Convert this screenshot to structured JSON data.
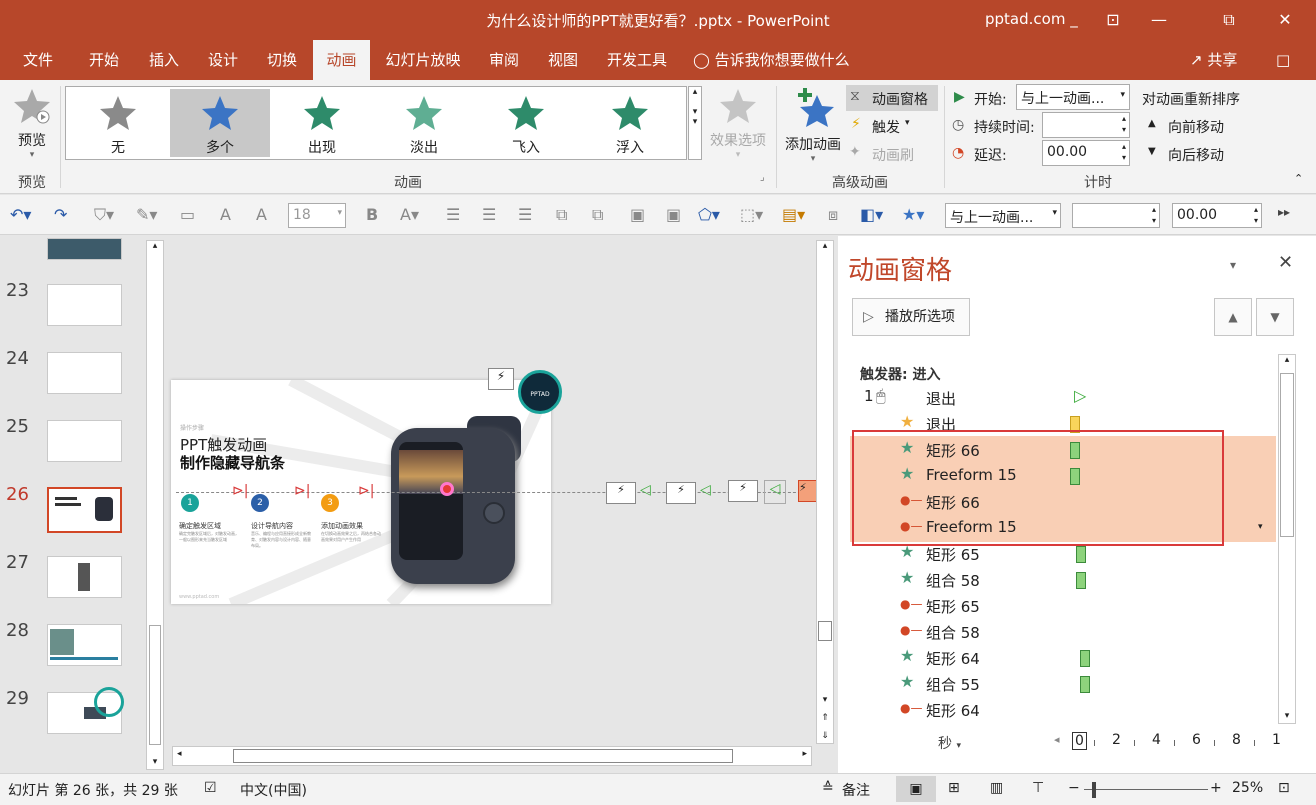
{
  "window": {
    "title": "为什么设计师的PPT就更好看？.pptx  -  PowerPoint",
    "account": "pptad.com _",
    "min": "—",
    "restore": "⧉",
    "close": "✕",
    "ribbon_opt": "⊡"
  },
  "tabs": [
    {
      "label": "文件"
    },
    {
      "label": "开始"
    },
    {
      "label": "插入"
    },
    {
      "label": "设计"
    },
    {
      "label": "切换"
    },
    {
      "label": "动画"
    },
    {
      "label": "幻灯片放映"
    },
    {
      "label": "审阅"
    },
    {
      "label": "视图"
    },
    {
      "label": "开发工具"
    },
    {
      "label": "告诉我你想要做什么"
    }
  ],
  "share_label": "共享",
  "ribbon": {
    "preview_label": "预览",
    "preview_group": "预览",
    "gallery": [
      {
        "label": "无",
        "color": "#8a8a8a"
      },
      {
        "label": "多个",
        "color": "#3b74c4"
      },
      {
        "label": "出现",
        "color": "#2e8b6a"
      },
      {
        "label": "淡出",
        "color": "#5fae93"
      },
      {
        "label": "飞入",
        "color": "#2e8b6a"
      },
      {
        "label": "浮入",
        "color": "#2e8b6a"
      }
    ],
    "effect_options": "效果选项",
    "animation_group": "动画",
    "add_animation": "添加动画",
    "anim_pane": "动画窗格",
    "trigger": "触发",
    "anim_painter": "动画刷",
    "advanced_group": "高级动画",
    "start_label": "开始:",
    "start_value": "与上一动画...",
    "duration_label": "持续时间:",
    "duration_value": "",
    "delay_label": "延迟:",
    "delay_value": "00.00",
    "reorder_label": "对动画重新排序",
    "move_earlier": "向前移动",
    "move_later": "向后移动",
    "timing_group": "计时"
  },
  "toolbar": {
    "font_size": "18",
    "start_value": "与上一动画...",
    "duration_value": "",
    "delay_value": "00.00"
  },
  "thumbnails": [
    {
      "num": "23"
    },
    {
      "num": "24"
    },
    {
      "num": "25"
    },
    {
      "num": "26"
    },
    {
      "num": "27"
    },
    {
      "num": "28"
    },
    {
      "num": "29"
    }
  ],
  "slide": {
    "kicker": "操作步骤",
    "title1": "PPT触发动画",
    "title2": "制作隐藏导航条",
    "badge": "PPTAD",
    "steps": [
      {
        "num": "1",
        "label": "确定触发区域",
        "desc": "确定完触发区域后，对触发动画，一般以图形来充当触发区域",
        "color": "#1aa39a"
      },
      {
        "num": "2",
        "label": "设计导航内容",
        "desc": "音乐、编程与应用直接形成全新教育、对触发内容与设计内容、随意布局。",
        "color": "#2b5fa8"
      },
      {
        "num": "3",
        "label": "添加动画效果",
        "desc": "在切换动画效果之后，再结合各动画效果对用户产生作用",
        "color": "#f39c12"
      }
    ],
    "footer": "www.pptad.com"
  },
  "anim_pane": {
    "title": "动画窗格",
    "play": "播放所选项",
    "trigger_header": "触发器: 进入",
    "rows": [
      {
        "num": "1",
        "icon": "mouse",
        "label": "退出",
        "bar": "play"
      },
      {
        "num": "",
        "icon": "star-yellow",
        "label": "退出",
        "bar": "yellow"
      },
      {
        "num": "",
        "icon": "star",
        "label": "矩形 66",
        "bar": "green"
      },
      {
        "num": "",
        "icon": "star",
        "label": "Freeform 15",
        "bar": "green"
      },
      {
        "num": "",
        "icon": "path",
        "label": "矩形 66",
        "bar": ""
      },
      {
        "num": "",
        "icon": "path",
        "label": "Freeform 15",
        "bar": ""
      },
      {
        "num": "",
        "icon": "star",
        "label": "矩形 65",
        "bar": "green"
      },
      {
        "num": "",
        "icon": "star",
        "label": "组合 58",
        "bar": "green"
      },
      {
        "num": "",
        "icon": "path",
        "label": "矩形 65",
        "bar": ""
      },
      {
        "num": "",
        "icon": "path",
        "label": "组合 58",
        "bar": ""
      },
      {
        "num": "",
        "icon": "star",
        "label": "矩形 64",
        "bar": "green"
      },
      {
        "num": "",
        "icon": "star",
        "label": "组合 55",
        "bar": "green"
      },
      {
        "num": "",
        "icon": "path",
        "label": "矩形 64",
        "bar": ""
      }
    ],
    "seconds": "秒",
    "timeline": [
      "0",
      "2",
      "4",
      "6",
      "8",
      "1"
    ]
  },
  "status": {
    "slide_info": "幻灯片 第 26 张，共 29 张",
    "language": "中文(中国)",
    "notes": "备注",
    "zoom": "25%"
  }
}
